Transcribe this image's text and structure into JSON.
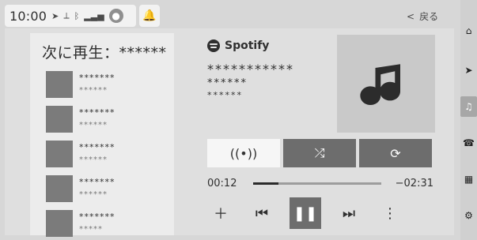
{
  "status": {
    "time": "10:00",
    "icons": [
      "navigation-arrow-icon",
      "no-signal-icon",
      "bluetooth-icon",
      "signal-icon",
      "person-icon"
    ]
  },
  "header": {
    "back_label": "戻る",
    "back_chevron": "<"
  },
  "queue": {
    "title": "次に再生：******",
    "items": [
      {
        "line1": "*******",
        "line2": "******"
      },
      {
        "line1": "*******",
        "line2": "******"
      },
      {
        "line1": "*******",
        "line2": "******"
      },
      {
        "line1": "*******",
        "line2": "******"
      },
      {
        "line1": "*******",
        "line2": "*****"
      }
    ]
  },
  "now_playing": {
    "service": "Spotify",
    "title_line1": "***********",
    "title_line2": "******",
    "title_line3": "******",
    "elapsed": "00:12",
    "remaining": "−02:31",
    "progress_percent": 20
  },
  "controls": {
    "top_buttons": [
      {
        "icon": "broadcast-icon",
        "style": "light"
      },
      {
        "icon": "shuffle-icon",
        "style": "dark"
      },
      {
        "icon": "repeat-icon",
        "style": "dark"
      }
    ],
    "bottom_buttons": [
      {
        "icon": "add-icon"
      },
      {
        "icon": "previous-icon"
      },
      {
        "icon": "pause-icon"
      },
      {
        "icon": "next-icon"
      },
      {
        "icon": "more-vertical-icon"
      }
    ]
  },
  "right_nav": [
    {
      "icon": "home-icon",
      "active": false
    },
    {
      "icon": "navigation-icon",
      "active": false
    },
    {
      "icon": "music-icon",
      "active": true
    },
    {
      "icon": "phone-icon",
      "active": false
    },
    {
      "icon": "apps-icon",
      "active": false
    },
    {
      "icon": "settings-icon",
      "active": false
    }
  ]
}
